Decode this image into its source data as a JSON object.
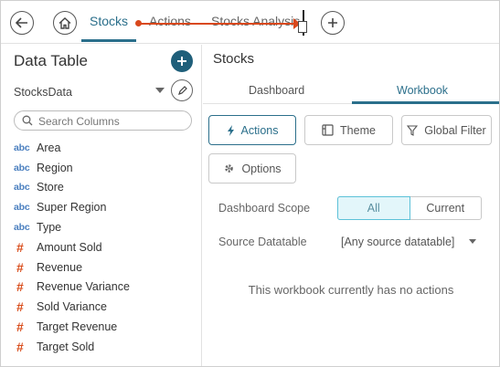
{
  "topbar": {
    "tabs": [
      {
        "label": "Stocks",
        "active": true
      },
      {
        "label": "Actions",
        "active": false
      },
      {
        "label": "Stocks Analysis",
        "active": false
      }
    ],
    "back_icon": "arrow-left-icon",
    "home_icon": "home-icon",
    "add_icon": "plus-icon"
  },
  "data_table": {
    "title": "Data Table",
    "datasource": "StocksData",
    "search_placeholder": "Search Columns",
    "columns": [
      {
        "type": "abc",
        "name": "Area"
      },
      {
        "type": "abc",
        "name": "Region"
      },
      {
        "type": "abc",
        "name": "Store"
      },
      {
        "type": "abc",
        "name": "Super Region"
      },
      {
        "type": "abc",
        "name": "Type"
      },
      {
        "type": "#",
        "name": "Amount Sold"
      },
      {
        "type": "#",
        "name": "Revenue"
      },
      {
        "type": "#",
        "name": "Revenue Variance"
      },
      {
        "type": "#",
        "name": "Sold Variance"
      },
      {
        "type": "#",
        "name": "Target Revenue"
      },
      {
        "type": "#",
        "name": "Target Sold"
      }
    ]
  },
  "panel": {
    "title": "Stocks",
    "tabs": [
      {
        "label": "Dashboard",
        "active": false
      },
      {
        "label": "Workbook",
        "active": true
      }
    ],
    "buttons": {
      "actions": "Actions",
      "theme": "Theme",
      "global_filter": "Global Filter",
      "options": "Options"
    },
    "scope_label": "Dashboard Scope",
    "scope_options": [
      "All",
      "Current"
    ],
    "scope_selected": "All",
    "source_label": "Source Datatable",
    "source_value": "[Any source datatable]",
    "empty_message": "This workbook currently has no actions"
  },
  "colors": {
    "accent": "#2b6f8b",
    "fab": "#1f5f7a",
    "drag_indicator": "#d9481c",
    "text_type": "#4a7fbf",
    "numeric_type": "#d94f1e"
  }
}
